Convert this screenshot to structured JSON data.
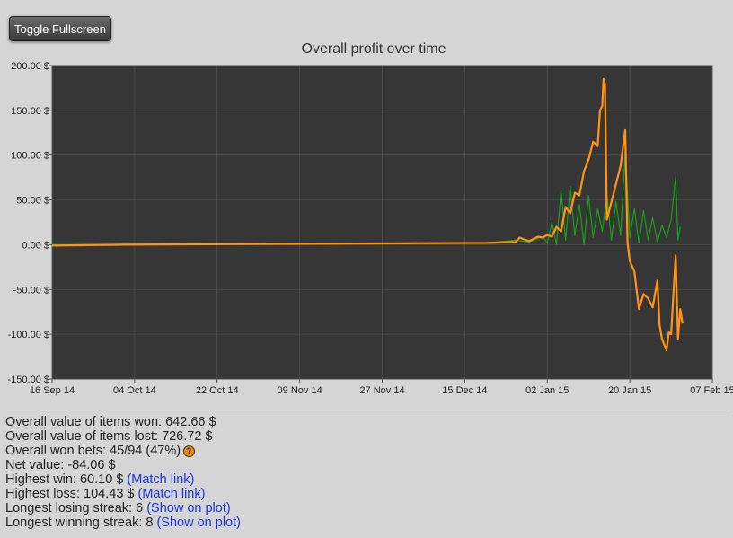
{
  "toolbar": {
    "toggle_fullscreen_label": "Toggle Fullscreen"
  },
  "colors": {
    "plot_background": "#363636",
    "grid": "#4a4a4a",
    "series_orange": "#ff9416",
    "series_green": "#18a018",
    "link": "#1a33e0",
    "help_icon": "#f08a00"
  },
  "chart_data": {
    "type": "line",
    "title": "Overall profit over time",
    "x_axis": {
      "type": "date",
      "range": [
        "2014-09-16",
        "2015-02-07"
      ],
      "ticks": [
        "16 Sep 14",
        "04 Oct 14",
        "22 Oct 14",
        "09 Nov 14",
        "27 Nov 14",
        "15 Dec 14",
        "02 Jan 15",
        "20 Jan 15",
        "07 Feb 15"
      ]
    },
    "y_axis": {
      "range": [
        -150,
        200
      ],
      "ticks": [
        "200.00 $",
        "150.00 $",
        "100.00 $",
        "50.00 $",
        "0.00 $",
        "-50.00 $",
        "-100.00 $",
        "-150.00 $"
      ]
    },
    "grid": true,
    "series": [
      {
        "color": "#ff9416",
        "points": [
          [
            "2014-09-16",
            -1
          ],
          [
            "2014-10-01",
            0
          ],
          [
            "2014-10-20",
            0.5
          ],
          [
            "2014-11-10",
            1
          ],
          [
            "2014-12-01",
            1.5
          ],
          [
            "2014-12-20",
            2
          ],
          [
            "2014-12-26",
            3
          ],
          [
            "2014-12-27",
            8
          ],
          [
            "2014-12-29",
            4
          ],
          [
            "2014-12-31",
            9
          ],
          [
            "2015-01-01",
            8
          ],
          [
            "2015-01-02",
            11
          ],
          [
            "2015-01-03",
            9
          ],
          [
            "2015-01-04",
            20
          ],
          [
            "2015-01-05",
            15
          ],
          [
            "2015-01-06",
            42
          ],
          [
            "2015-01-07",
            35
          ],
          [
            "2015-01-08",
            58
          ],
          [
            "2015-01-09",
            55
          ],
          [
            "2015-01-10",
            82
          ],
          [
            "2015-01-11",
            95
          ],
          [
            "2015-01-12",
            115
          ],
          [
            "2015-01-13",
            110
          ],
          [
            "2015-01-13T12:00",
            150
          ],
          [
            "2015-01-14",
            155
          ],
          [
            "2015-01-14T06:00",
            185
          ],
          [
            "2015-01-14T14:00",
            180
          ],
          [
            "2015-01-15",
            28
          ],
          [
            "2015-01-18",
            88
          ],
          [
            "2015-01-19",
            128
          ],
          [
            "2015-01-19T12:00",
            2
          ],
          [
            "2015-01-20",
            -18
          ],
          [
            "2015-01-21",
            -30
          ],
          [
            "2015-01-22",
            -72
          ],
          [
            "2015-01-23",
            -55
          ],
          [
            "2015-01-24",
            -60
          ],
          [
            "2015-01-25",
            -70
          ],
          [
            "2015-01-26",
            -40
          ],
          [
            "2015-01-26T12:00",
            -90
          ],
          [
            "2015-01-27",
            -105
          ],
          [
            "2015-01-28",
            -118
          ],
          [
            "2015-01-28T12:00",
            -98
          ],
          [
            "2015-01-29",
            -100
          ],
          [
            "2015-01-30",
            -12
          ],
          [
            "2015-01-30T12:00",
            -105
          ],
          [
            "2015-01-31",
            -72
          ],
          [
            "2015-01-31T12:00",
            -88
          ]
        ]
      },
      {
        "color": "#18a018",
        "points": [
          [
            "2014-09-16",
            0
          ],
          [
            "2014-10-20",
            0.5
          ],
          [
            "2014-11-20",
            1
          ],
          [
            "2014-12-20",
            2
          ],
          [
            "2014-12-26",
            5
          ],
          [
            "2014-12-29",
            3
          ],
          [
            "2015-01-01",
            9
          ],
          [
            "2015-01-02",
            2
          ],
          [
            "2015-01-03",
            25
          ],
          [
            "2015-01-04",
            0
          ],
          [
            "2015-01-05",
            60
          ],
          [
            "2015-01-06",
            5
          ],
          [
            "2015-01-07",
            65
          ],
          [
            "2015-01-08",
            10
          ],
          [
            "2015-01-09",
            45
          ],
          [
            "2015-01-10",
            0
          ],
          [
            "2015-01-11",
            55
          ],
          [
            "2015-01-12",
            8
          ],
          [
            "2015-01-13",
            40
          ],
          [
            "2015-01-14",
            15
          ],
          [
            "2015-01-15",
            55
          ],
          [
            "2015-01-16",
            5
          ],
          [
            "2015-01-17",
            48
          ],
          [
            "2015-01-18",
            10
          ],
          [
            "2015-01-19",
            105
          ],
          [
            "2015-01-20",
            8
          ],
          [
            "2015-01-21",
            40
          ],
          [
            "2015-01-22",
            2
          ],
          [
            "2015-01-23",
            38
          ],
          [
            "2015-01-24",
            5
          ],
          [
            "2015-01-25",
            30
          ],
          [
            "2015-01-26",
            3
          ],
          [
            "2015-01-27",
            22
          ],
          [
            "2015-01-28",
            8
          ],
          [
            "2015-01-29",
            28
          ],
          [
            "2015-01-30",
            76
          ],
          [
            "2015-01-30T12:00",
            5
          ],
          [
            "2015-01-31",
            20
          ]
        ]
      }
    ]
  },
  "stats": {
    "items_won": "Overall value of items won: 642.66 $",
    "items_lost": "Overall value of items lost: 726.72 $",
    "won_bets": "Overall won bets: 45/94 (47%)",
    "help_icon_glyph": "?",
    "net_value": "Net value: -84.06 $",
    "highest_win": "Highest win: 60.10 $",
    "highest_win_link": "(Match link)",
    "highest_loss": "Highest loss: 104.43 $",
    "highest_loss_link": "(Match link)",
    "losing_streak": "Longest losing streak: 6",
    "losing_streak_link": "(Show on plot)",
    "winning_streak": "Longest winning streak: 8",
    "winning_streak_link": "(Show on plot)"
  }
}
